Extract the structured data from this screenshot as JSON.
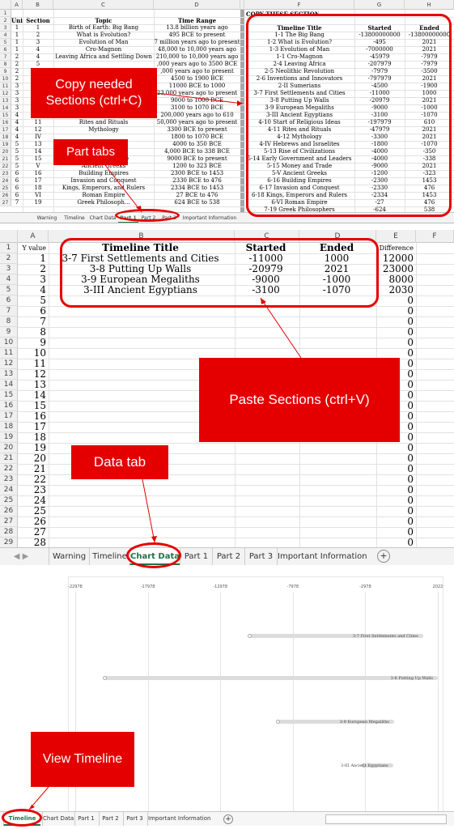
{
  "panel1": {
    "columns": [
      "A",
      "B",
      "C",
      "D",
      "",
      "F",
      "G",
      "H"
    ],
    "left_headers": [
      "Unit",
      "Section",
      "Topic",
      "Time Range"
    ],
    "left_rows": [
      [
        "1",
        "1",
        "Birth of Earth: Big Bang",
        "13.8 billion years ago"
      ],
      [
        "1",
        "2",
        "What is Evolution?",
        "495 BCE to present"
      ],
      [
        "1",
        "3",
        "Evolution of Man",
        "7 million years ago to present"
      ],
      [
        "1",
        "4",
        "Cro-Magnon",
        "48,000 to 10,000 years ago"
      ],
      [
        "2",
        "4",
        "Leaving Africa and Settling Down",
        "210,000 to 10,000 years ago"
      ],
      [
        "2",
        "5",
        "",
        ",000 years ago to 3500 BCE"
      ],
      [
        "2",
        "6",
        "",
        ",000 years ago to present"
      ],
      [
        "2",
        "",
        "",
        "4500 to 1900 BCE"
      ],
      [
        "3",
        "",
        "",
        "11000 BCE to 1000"
      ],
      [
        "3",
        "",
        "",
        "23,000 years ago to present"
      ],
      [
        "3",
        "",
        "",
        "9000 to 1000 BCE"
      ],
      [
        "3",
        "",
        "",
        "3100 to 1070 BCE"
      ],
      [
        "4",
        "10",
        "...es for Religious Ideas",
        "200,000 years ago to 610"
      ],
      [
        "4",
        "11",
        "Rites and Rituals",
        "50,000 years ago to present"
      ],
      [
        "4",
        "12",
        "Mythology",
        "3300 BCE to present"
      ],
      [
        "4",
        "IV",
        "",
        "1800 to 1070 BCE"
      ],
      [
        "5",
        "13",
        "",
        "4000 to 350 BCE"
      ],
      [
        "5",
        "14",
        "...aders",
        "4,000 BCE to 338 BCE"
      ],
      [
        "5",
        "15",
        "Money and Trade",
        "9000 BCE to present"
      ],
      [
        "5",
        "V",
        "Ancient Greeks",
        "1200 to 323 BCE"
      ],
      [
        "6",
        "16",
        "Building Empires",
        "2300 BCE to 1453"
      ],
      [
        "6",
        "17",
        "Invasion and Conquest",
        "2330 BCE to 476"
      ],
      [
        "6",
        "18",
        "Kings, Emperors, and Rulers",
        "2334 BCE to 1453"
      ],
      [
        "6",
        "VI",
        "Roman Empire",
        "27 BCE to 476"
      ],
      [
        "7",
        "19",
        "Greek Philosoph...",
        "624 BCE to 538"
      ]
    ],
    "right_title": "COPY THESE SECTIONS:",
    "right_headers": [
      "Timeline Title",
      "Started",
      "Ended"
    ],
    "right_rows": [
      [
        "1-1 The Big Bang",
        "-13800000000",
        "-13800000000"
      ],
      [
        "1-2 What is Evolution?",
        "-495",
        "2021"
      ],
      [
        "1-3 Evolution of Man",
        "-7000000",
        "2021"
      ],
      [
        "1-1 Cro-Magnon",
        "-45979",
        "-7979"
      ],
      [
        "2-4 Leaving Africa",
        "-207979",
        "-7979"
      ],
      [
        "2-5 Neolithic Revolution",
        "-7979",
        "-3500"
      ],
      [
        "2-6 Inventions and Innovators",
        "-797979",
        "2021"
      ],
      [
        "2-II Sumerians",
        "-4500",
        "-1900"
      ],
      [
        "3-7 First Settlements and Cities",
        "-11000",
        "1000"
      ],
      [
        "3-8 Putting Up Walls",
        "-20979",
        "2021"
      ],
      [
        "3-9 European Megaliths",
        "-9000",
        "-1000"
      ],
      [
        "3-III Ancient Egyptians",
        "-3100",
        "-1070"
      ],
      [
        "4-10 Start of Religious Ideas",
        "-197979",
        "610"
      ],
      [
        "4-11 Rites and Rituals",
        "-47979",
        "2021"
      ],
      [
        "4-12 Mythology",
        "-3300",
        "2021"
      ],
      [
        "4-IV Hebrews and Israelites",
        "-1800",
        "-1070"
      ],
      [
        "5-13 Rise of Civilizations",
        "-4000",
        "-350"
      ],
      [
        "5-14 Early Government and Leaders",
        "-4000",
        "-338"
      ],
      [
        "5-15 Money and Trade",
        "-9000",
        "2021"
      ],
      [
        "5-V Ancient Greeks",
        "-1200",
        "-323"
      ],
      [
        "6-16 Building Empires",
        "-2300",
        "1453"
      ],
      [
        "6-17 Invasion and Conquest",
        "-2330",
        "476"
      ],
      [
        "6-18 Kings, Emperors and Rulers",
        "-2334",
        "1453"
      ],
      [
        "6-VI Roman Empire",
        "-27",
        "476"
      ],
      [
        "7-19 Greek Philosophers",
        "-624",
        "538"
      ]
    ],
    "tabs": [
      "Warning",
      "Timeline",
      "Chart Data",
      "Part 1",
      "Part 2",
      "Part 3",
      "Important Information"
    ],
    "callout_copy": "Copy needed Sections (ctrl+C)",
    "callout_tabs": "Part tabs"
  },
  "panel2": {
    "columns": [
      "A",
      "B",
      "C",
      "D",
      "E",
      "F"
    ],
    "headers": [
      "Y value",
      "Timeline Title",
      "Started",
      "Ended",
      "Difference"
    ],
    "rows": [
      [
        "1",
        "3-7 First Settlements and Cities",
        "-11000",
        "1000",
        "12000"
      ],
      [
        "2",
        "3-8 Putting Up Walls",
        "-20979",
        "2021",
        "23000"
      ],
      [
        "3",
        "3-9 European Megaliths",
        "-9000",
        "-1000",
        "8000"
      ],
      [
        "4",
        "3-III Ancient Egyptians",
        "-3100",
        "-1070",
        "2030"
      ]
    ],
    "empty_y_values": [
      "5",
      "6",
      "7",
      "8",
      "9",
      "10",
      "11",
      "12",
      "13",
      "14",
      "15",
      "16",
      "17",
      "18",
      "19",
      "20",
      "21",
      "22",
      "23",
      "24",
      "25",
      "26",
      "27",
      "28"
    ],
    "zero": "0",
    "tabs": [
      "Warning",
      "Timeline",
      "Chart Data",
      "Part 1",
      "Part 2",
      "Part 3",
      "Important Information"
    ],
    "add_sheet": "+",
    "callout_paste": "Paste Sections (ctrl+V)",
    "callout_data": "Data tab"
  },
  "panel3": {
    "axis_ticks": [
      "-22978",
      "-17978",
      "-12978",
      "-7978",
      "-2978",
      "2022"
    ],
    "bars": [
      {
        "label": "3-7 First Settlements and Cities",
        "start": -11000,
        "end": 1000
      },
      {
        "label": "3-8 Putting Up Walls",
        "start": -20979,
        "end": 2021
      },
      {
        "label": "3-9 European Megaliths",
        "start": -9000,
        "end": -1000
      },
      {
        "label": "3-III Ancient Egyptians",
        "start": -3100,
        "end": -1070
      }
    ],
    "tabs": [
      "Timeline",
      "Chart Data",
      "Part 1",
      "Part 2",
      "Part 3",
      "Important Information"
    ],
    "add_sheet": "+",
    "callout_view": "View Timeline"
  },
  "colors": {
    "accent_red": "#e40000",
    "excel_green": "#217346"
  }
}
